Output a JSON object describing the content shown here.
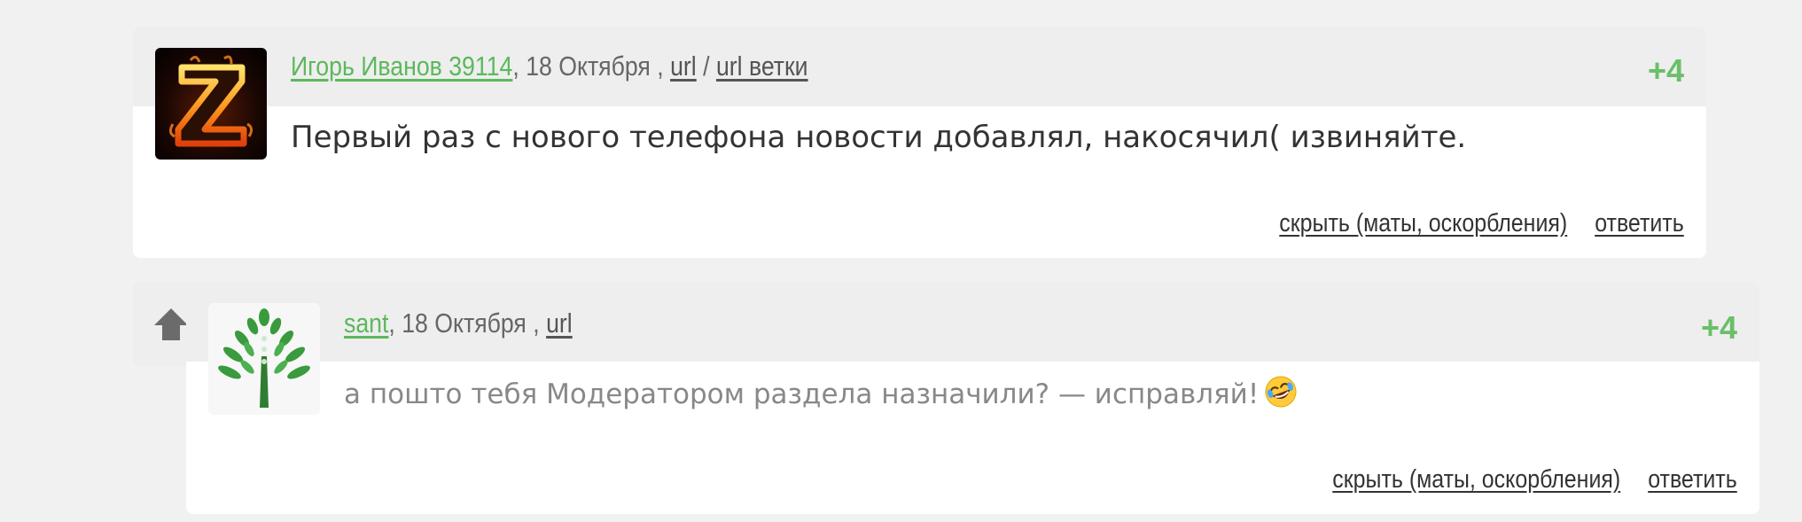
{
  "comments": [
    {
      "author": "Игорь Иванов 39114",
      "date_sep": ", ",
      "date": "18 Октября ,",
      "link_url": "url",
      "link_sep": "/",
      "link_branch": "url ветки",
      "rating": "+4",
      "text": "Первый раз с нового телефона новости добавлял, накосячил( извиняйте.",
      "hide_label": "скрыть (маты, оскорбления)",
      "reply_label": "ответить",
      "avatar_icon": "fire-z-avatar"
    },
    {
      "author": "sant",
      "date_sep": ", ",
      "date": "18 Октября ,",
      "link_url": "url",
      "rating": "+4",
      "text": "а пошто тебя Модератором раздела назначили? — исправляй!",
      "emoji_icon": "rolling-on-floor-laughing-icon",
      "hide_label": "скрыть (маты, оскорбления)",
      "reply_label": "ответить",
      "avatar_icon": "green-tree-avatar",
      "parent_icon": "arrow-up-icon"
    }
  ],
  "colors": {
    "author": "#5cb85c",
    "rating": "#6abf69",
    "header_bg": "#eeeeee",
    "page_bg": "#f1f1f1"
  }
}
